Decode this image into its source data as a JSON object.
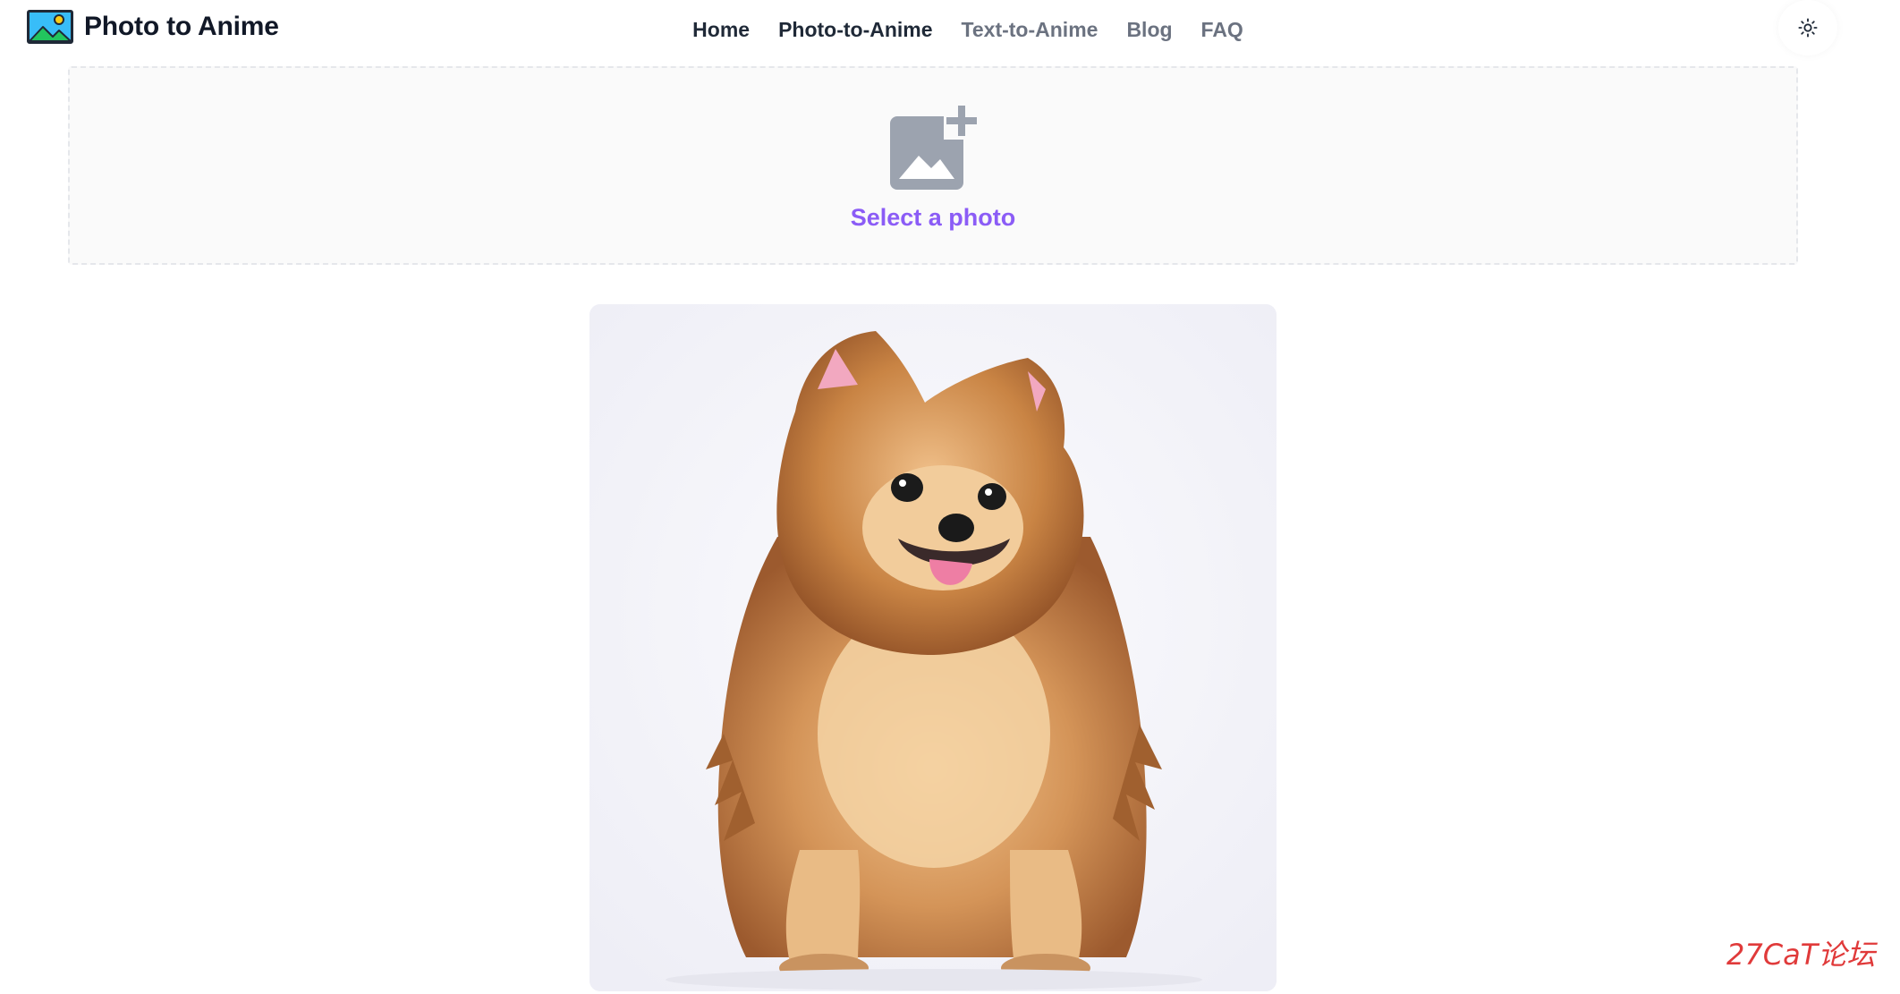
{
  "header": {
    "brand_name": "Photo to Anime",
    "brand_logo_icon": "landscape-image-icon",
    "nav": [
      {
        "label": "Home",
        "active": true
      },
      {
        "label": "Photo-to-Anime",
        "active": true
      },
      {
        "label": "Text-to-Anime",
        "active": false
      },
      {
        "label": "Blog",
        "active": false
      },
      {
        "label": "FAQ",
        "active": false
      }
    ],
    "theme_toggle_icon": "sun-icon"
  },
  "upload": {
    "icon": "add-photo-icon",
    "label": "Select a photo"
  },
  "result": {
    "image": "anime-style-pomeranian-dog"
  },
  "watermark": {
    "text": "27CaT论坛"
  },
  "colors": {
    "accent": "#8b5cf6",
    "text_dark": "#1f2937",
    "text_muted": "#6b7280",
    "watermark": "#e03a3a"
  }
}
